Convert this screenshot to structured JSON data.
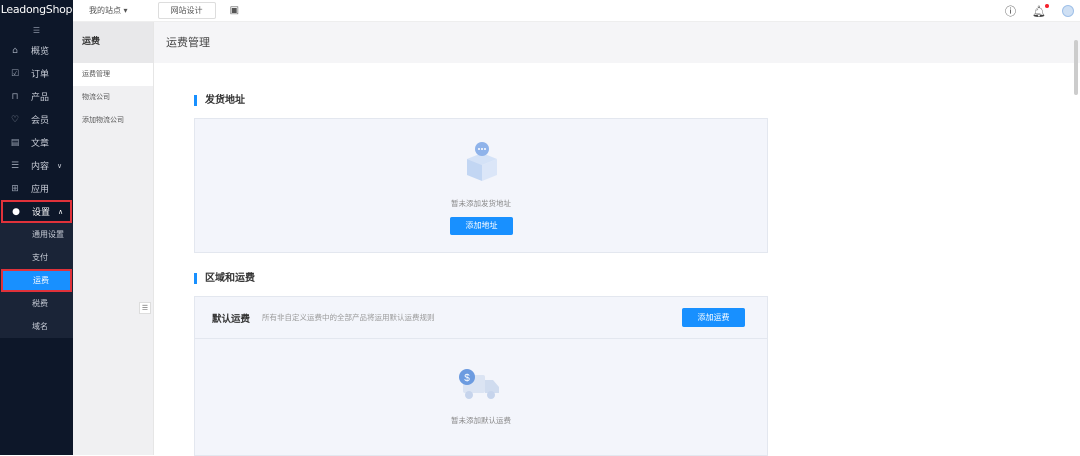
{
  "app": {
    "logo": "LeadongShop"
  },
  "topbar": {
    "site_label": "我的站点",
    "design_label": "网站设计"
  },
  "sidebar": {
    "items": [
      {
        "label": "概览",
        "icon": "home-icon"
      },
      {
        "label": "订单",
        "icon": "order-icon"
      },
      {
        "label": "产品",
        "icon": "bag-icon"
      },
      {
        "label": "会员",
        "icon": "member-icon"
      },
      {
        "label": "文章",
        "icon": "document-icon"
      },
      {
        "label": "内容",
        "icon": "content-icon"
      },
      {
        "label": "应用",
        "icon": "apps-icon"
      },
      {
        "label": "设置",
        "icon": "gear-icon"
      }
    ],
    "sub_items": [
      "通用设置",
      "支付",
      "运费",
      "税费",
      "域名"
    ]
  },
  "panel2": {
    "title": "运费",
    "items": [
      "运费管理",
      "物流公司",
      "添加物流公司"
    ]
  },
  "content": {
    "title": "运费管理",
    "shipping_address": {
      "title": "发货地址",
      "empty": "暂未添加发货地址",
      "button": "添加地址"
    },
    "regions": {
      "title": "区域和运费",
      "default_title": "默认运费",
      "default_desc": "所有非自定义运费中的全部产品将运用默认运费规则",
      "button": "添加运费",
      "empty": "暂未添加默认运费"
    }
  },
  "colors": {
    "accent": "#1890ff",
    "sidebar": "#0d1729",
    "highlight": "#e0323a"
  }
}
